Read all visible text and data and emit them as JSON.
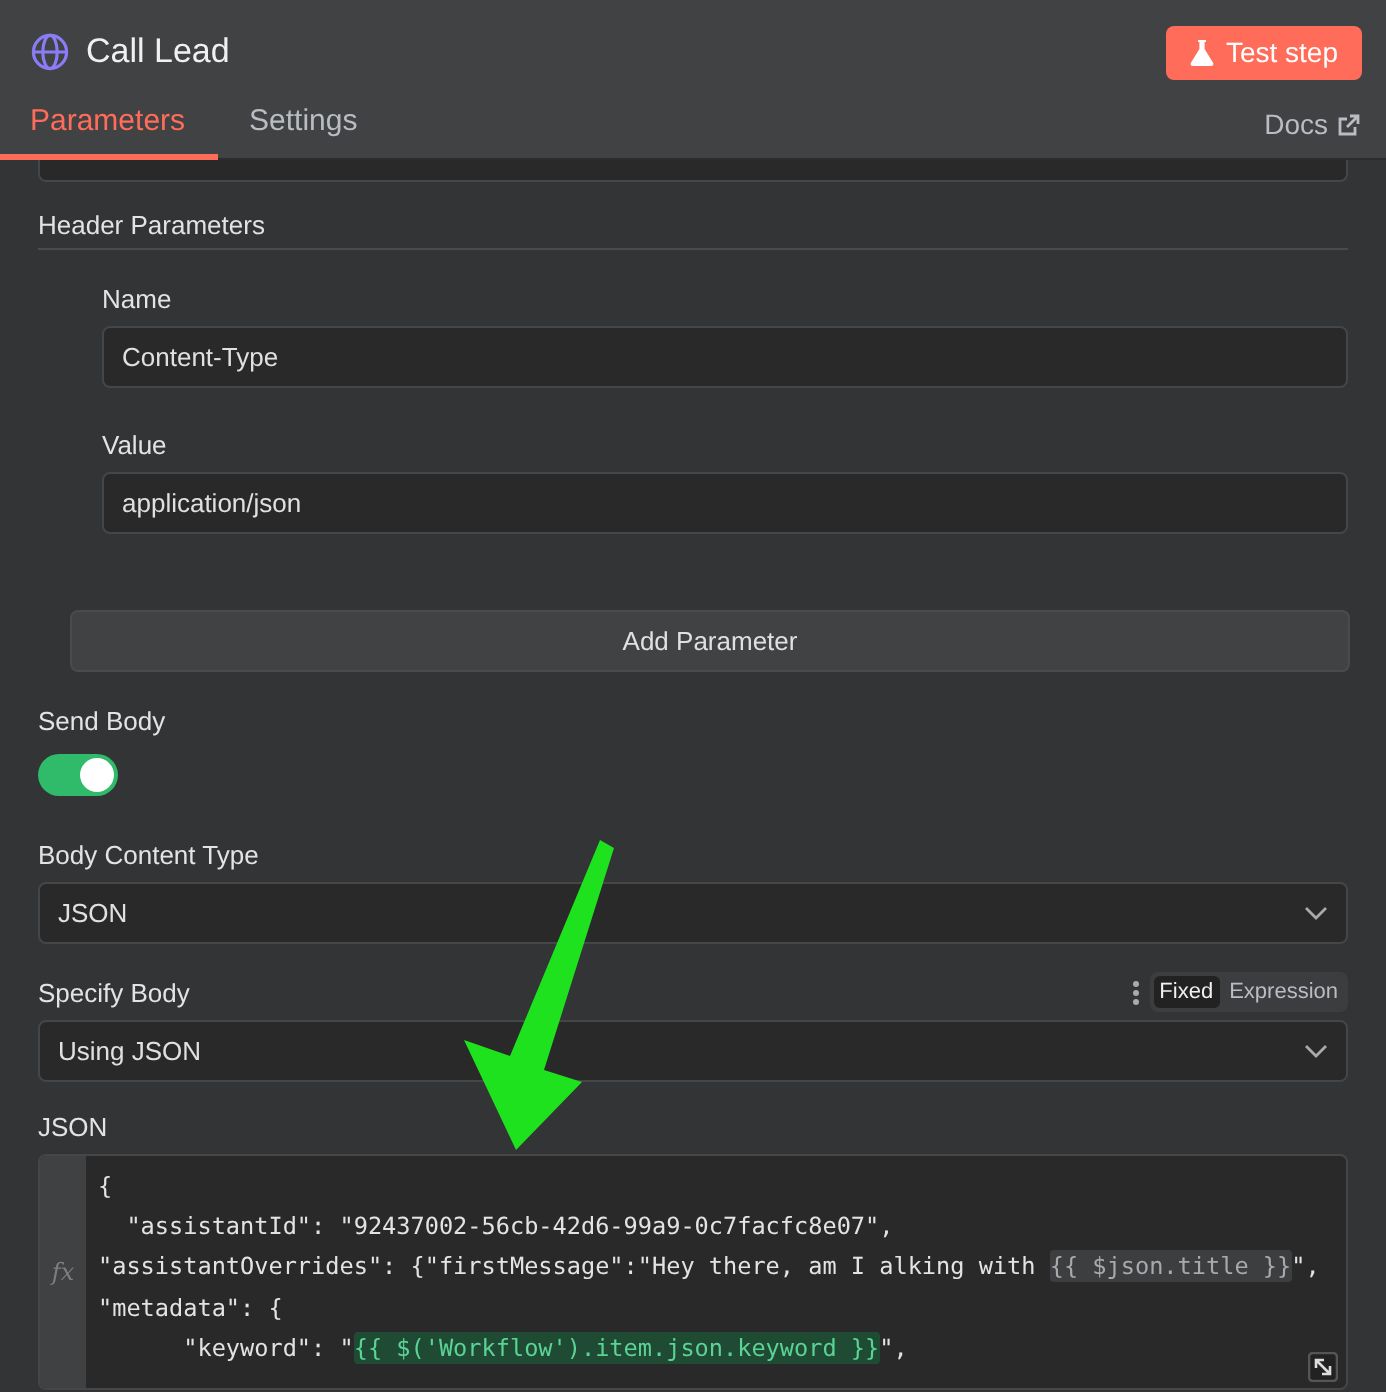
{
  "header": {
    "title": "Call Lead",
    "test_button": "Test step"
  },
  "tabs": [
    {
      "label": "Parameters",
      "selected": true
    },
    {
      "label": "Settings",
      "selected": false
    }
  ],
  "docs_link": "Docs",
  "header_parameters": {
    "title": "Header Parameters",
    "fields": [
      {
        "label": "Name",
        "value": "Content-Type"
      },
      {
        "label": "Value",
        "value": "application/json"
      }
    ]
  },
  "add_parameter_button": "Add Parameter",
  "send_body": {
    "label": "Send Body",
    "on": true
  },
  "body_content_type": {
    "label": "Body Content Type",
    "value": "JSON"
  },
  "specify_body": {
    "label": "Specify Body",
    "value": "Using JSON",
    "modes": [
      {
        "label": "Fixed",
        "selected": true
      },
      {
        "label": "Expression",
        "selected": false
      }
    ]
  },
  "json_editor": {
    "label": "JSON",
    "gutter": "fx",
    "lines": [
      [
        {
          "kind": "plain",
          "text": "{"
        }
      ],
      [
        {
          "kind": "plain",
          "text": "  \"assistantId\": \"92437002-56cb-42d6-99a9-0c7facfc8e07\","
        }
      ],
      [
        {
          "kind": "plain",
          "text": "\"assistantOverrides\": {\"firstMessage\":\"Hey there, am I alking with "
        },
        {
          "kind": "expression",
          "resolved": false,
          "text": "{{ $json.title }}"
        },
        {
          "kind": "plain",
          "text": "\","
        }
      ],
      [
        {
          "kind": "plain",
          "text": "\"metadata\": {"
        }
      ],
      [
        {
          "kind": "plain",
          "text": "      \"keyword\": \""
        },
        {
          "kind": "expression",
          "resolved": true,
          "text": "{{ $('Workflow').item.json.keyword }}"
        },
        {
          "kind": "plain",
          "text": "\","
        }
      ]
    ]
  }
}
